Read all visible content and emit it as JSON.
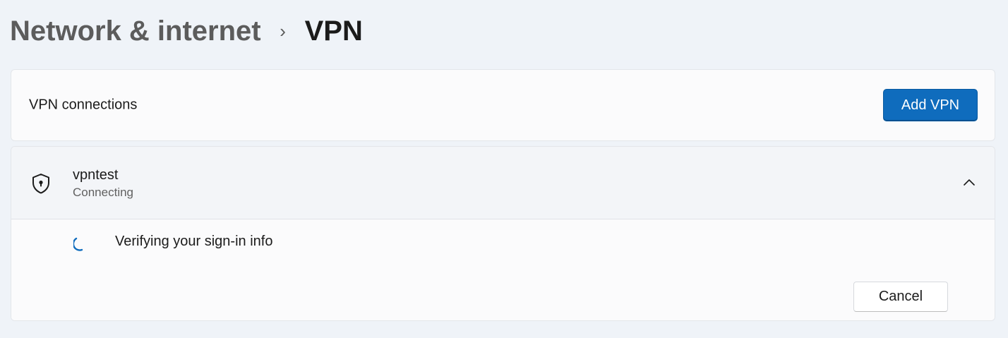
{
  "breadcrumb": {
    "parent": "Network & internet",
    "separator": "›",
    "current": "VPN"
  },
  "vpn_connections": {
    "label": "VPN connections",
    "add_button_label": "Add VPN"
  },
  "connection": {
    "name": "vpntest",
    "status": "Connecting",
    "icon": "shield-lock-icon",
    "expanded": true,
    "progress_text": "Verifying your sign-in info",
    "cancel_button_label": "Cancel"
  },
  "colors": {
    "accent": "#0f6cbd",
    "background": "#eff3f8",
    "card": "#fbfbfc",
    "spinner": "#0f6cbd"
  }
}
